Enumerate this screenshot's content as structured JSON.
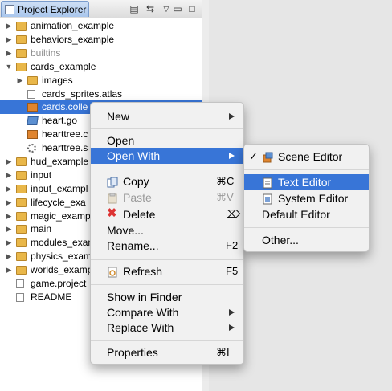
{
  "view": {
    "title": "Project Explorer"
  },
  "tree": [
    {
      "label": "animation_example",
      "kind": "folder",
      "twisty": "▶",
      "level": 0
    },
    {
      "label": "behaviors_example",
      "kind": "folder",
      "twisty": "▶",
      "level": 0
    },
    {
      "label": "builtins",
      "kind": "folder",
      "twisty": "▶",
      "level": 0,
      "muted": true
    },
    {
      "label": "cards_example",
      "kind": "folder",
      "twisty": "▼",
      "level": 0
    },
    {
      "label": "images",
      "kind": "folder",
      "twisty": "▶",
      "level": 1
    },
    {
      "label": "cards_sprites.atlas",
      "kind": "doc",
      "twisty": "",
      "level": 1
    },
    {
      "label": "cards.colle",
      "kind": "orange",
      "twisty": "",
      "level": 1,
      "selected": true
    },
    {
      "label": "heart.go",
      "kind": "cube",
      "twisty": "",
      "level": 1
    },
    {
      "label": "hearttree.c",
      "kind": "orange",
      "twisty": "",
      "level": 1
    },
    {
      "label": "hearttree.s",
      "kind": "gear",
      "twisty": "",
      "level": 1
    },
    {
      "label": "hud_example",
      "kind": "folder",
      "twisty": "▶",
      "level": 0
    },
    {
      "label": "input",
      "kind": "folder",
      "twisty": "▶",
      "level": 0
    },
    {
      "label": "input_exampl",
      "kind": "folder",
      "twisty": "▶",
      "level": 0
    },
    {
      "label": "lifecycle_exa",
      "kind": "folder",
      "twisty": "▶",
      "level": 0
    },
    {
      "label": "magic_examp",
      "kind": "folder",
      "twisty": "▶",
      "level": 0
    },
    {
      "label": "main",
      "kind": "folder",
      "twisty": "▶",
      "level": 0
    },
    {
      "label": "modules_exam",
      "kind": "folder",
      "twisty": "▶",
      "level": 0
    },
    {
      "label": "physics_exam",
      "kind": "folder",
      "twisty": "▶",
      "level": 0
    },
    {
      "label": "worlds_examp",
      "kind": "folder",
      "twisty": "▶",
      "level": 0
    },
    {
      "label": "game.project",
      "kind": "file",
      "twisty": "",
      "level": 0
    },
    {
      "label": "README",
      "kind": "doc",
      "twisty": "",
      "level": 0
    }
  ],
  "context_menu": {
    "new": "New",
    "open": "Open",
    "open_with": "Open With",
    "copy": "Copy",
    "copy_key": "⌘C",
    "paste": "Paste",
    "paste_key": "⌘V",
    "delete": "Delete",
    "delete_key": "⌦",
    "move": "Move...",
    "rename": "Rename...",
    "rename_key": "F2",
    "refresh": "Refresh",
    "refresh_key": "F5",
    "show_in_finder": "Show in Finder",
    "compare_with": "Compare With",
    "replace_with": "Replace With",
    "properties": "Properties",
    "properties_key": "⌘I"
  },
  "submenu": {
    "check": "✓",
    "scene_editor": "Scene Editor",
    "text_editor": "Text Editor",
    "system_editor": "System Editor",
    "default_editor": "Default Editor",
    "other": "Other..."
  },
  "colors": {
    "highlight": "#3875d7",
    "folder": "#e9b749"
  }
}
